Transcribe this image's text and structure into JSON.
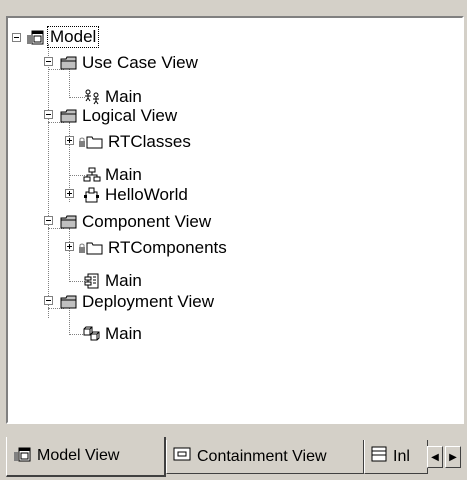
{
  "tree": {
    "root": {
      "label": "Model",
      "icon": "model-package-icon"
    },
    "nodes": [
      {
        "id": "use-case-view",
        "label": "Use Case View",
        "icon": "folder-icon"
      },
      {
        "id": "use-case-main",
        "label": "Main",
        "icon": "actor-diagram-icon"
      },
      {
        "id": "logical-view",
        "label": "Logical View",
        "icon": "folder-icon"
      },
      {
        "id": "rtclasses",
        "label": "RTClasses",
        "icon": "package-icon"
      },
      {
        "id": "logical-main",
        "label": "Main",
        "icon": "class-diagram-icon"
      },
      {
        "id": "helloworld",
        "label": "HelloWorld",
        "icon": "capsule-icon"
      },
      {
        "id": "component-view",
        "label": "Component View",
        "icon": "folder-icon"
      },
      {
        "id": "rtcomponents",
        "label": "RTComponents",
        "icon": "package-icon"
      },
      {
        "id": "component-main",
        "label": "Main",
        "icon": "component-diagram-icon"
      },
      {
        "id": "deployment-view",
        "label": "Deployment View",
        "icon": "folder-icon"
      },
      {
        "id": "deployment-main",
        "label": "Main",
        "icon": "deployment-diagram-icon"
      }
    ]
  },
  "tabs": [
    {
      "label": "Model View",
      "icon": "model-view-icon",
      "active": true
    },
    {
      "label": "Containment View",
      "icon": "containment-view-icon",
      "active": false
    },
    {
      "label": "Inl",
      "icon": "inheritance-view-icon",
      "active": false
    }
  ],
  "scroll": {
    "left": "◀",
    "right": "▶"
  }
}
